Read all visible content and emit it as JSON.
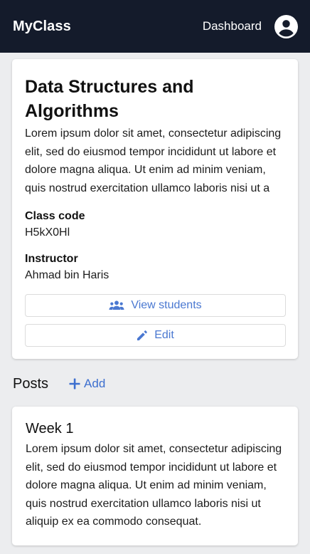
{
  "navbar": {
    "brand": "MyClass",
    "dashboard_label": "Dashboard",
    "background": "#141b2b"
  },
  "class_card": {
    "title": "Data Structures and Algorithms",
    "description": "Lorem ipsum dolor sit amet, consectetur adipiscing elit, sed do eiusmod tempor incididunt ut labore et dolore magna aliqua. Ut enim ad minim veniam, quis nostrud exercitation ullamco laboris nisi ut a",
    "class_code_label": "Class code",
    "class_code_value": "H5kX0Hl",
    "instructor_label": "Instructor",
    "instructor_value": "Ahmad bin Haris",
    "view_students_label": "View students",
    "edit_label": "Edit"
  },
  "posts": {
    "heading": "Posts",
    "add_label": "Add",
    "items": [
      {
        "title": "Week 1",
        "body": "Lorem ipsum dolor sit amet, consectetur adipiscing elit, sed do eiusmod tempor incididunt ut labore et dolore magna aliqua. Ut enim ad minim veniam, quis nostrud exercitation ullamco laboris nisi ut aliquip ex ea commodo consequat."
      }
    ]
  },
  "icons": {
    "profile": "account-circle-icon",
    "students": "people-icon",
    "edit": "pencil-icon",
    "add": "plus-icon"
  },
  "colors": {
    "accent": "#4a78d1",
    "page_background": "#ecedef"
  }
}
